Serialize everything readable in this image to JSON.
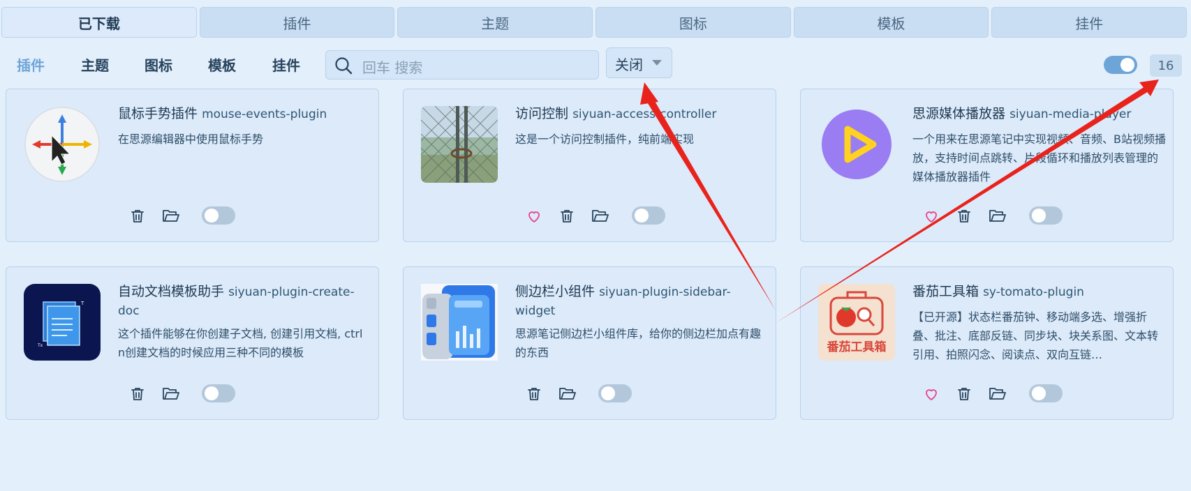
{
  "top_tabs": [
    "已下载",
    "插件",
    "主题",
    "图标",
    "模板",
    "挂件"
  ],
  "filter_tabs": [
    "插件",
    "主题",
    "图标",
    "模板",
    "挂件"
  ],
  "search": {
    "placeholder": "回车 搜索"
  },
  "dropdown": {
    "selected": "关闭"
  },
  "count": "16",
  "colors": {
    "accent": "#6ea5d8",
    "heart": "#e8458c",
    "arrow": "#e8231c",
    "background": "#e3effb"
  },
  "cards": [
    {
      "title": "鼠标手势插件",
      "pkg": "mouse-events-plugin",
      "desc": "在思源编辑器中使用鼠标手势",
      "favorite": false,
      "enabled": false,
      "icon": "mouse-gesture-icon"
    },
    {
      "title": "访问控制",
      "pkg": "siyuan-access-controller",
      "desc": "这是一个访问控制插件，纯前端实现",
      "favorite": true,
      "enabled": false,
      "icon": "locked-gate-photo"
    },
    {
      "title": "思源媒体播放器",
      "pkg": "siyuan-media-player",
      "desc": "一个用来在思源笔记中实现视频、音频、B站视频播放，支持时间点跳转、片段循环和播放列表管理的媒体播放器插件",
      "favorite": true,
      "enabled": false,
      "icon": "play-icon"
    },
    {
      "title": "自动文档模板助手",
      "pkg": "siyuan-plugin-create-doc",
      "desc": "这个插件能够在你创建子文档, 创建引用文档, ctrl n创建文档的时候应用三种不同的模板",
      "favorite": false,
      "enabled": false,
      "icon": "document-template-icon"
    },
    {
      "title": "侧边栏小组件",
      "pkg": "siyuan-plugin-sidebar-widget",
      "desc": "思源笔记侧边栏小组件库，给你的侧边栏加点有趣的东西",
      "favorite": false,
      "enabled": false,
      "icon": "sidebar-widget-icon"
    },
    {
      "title": "番茄工具箱",
      "pkg": "sy-tomato-plugin",
      "desc": "【已开源】状态栏番茄钟、移动端多选、增强折叠、批注、底部反链、同步块、块关系图、文本转引用、拍照闪念、阅读点、双向互链…",
      "favorite": true,
      "enabled": false,
      "icon": "tomato-toolbox-icon",
      "icon_text": "番茄工具箱"
    }
  ]
}
